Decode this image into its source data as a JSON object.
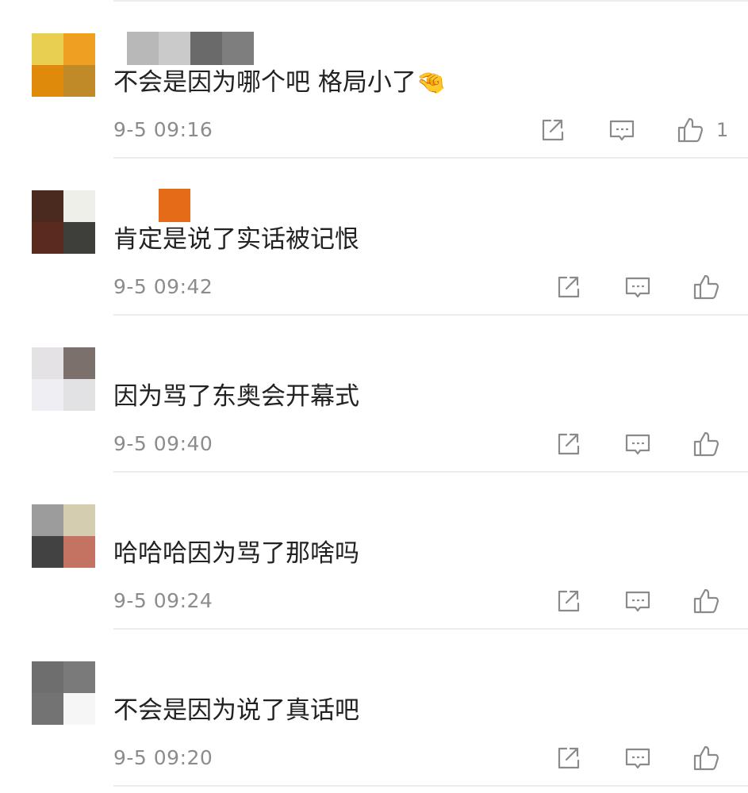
{
  "comments": [
    {
      "text": "不会是因为哪个吧 格局小了",
      "emoji": "🤏",
      "time": "9-5 09:16",
      "likes": "1",
      "avatar_colors": [
        "#e8cf50",
        "#f0a020",
        "#e08a0c",
        "#c08a28"
      ],
      "name_colors": [
        "#b8b8b8",
        "#cacaca",
        "#6a6a6a",
        "#7e7e7e"
      ]
    },
    {
      "text": "肯定是说了实话被记恨",
      "time": "9-5 09:42",
      "likes": "",
      "avatar_colors": [
        "#4a2a1f",
        "#efefe9",
        "#5a2a1e",
        "#3e3e3a"
      ],
      "name_colors": [
        "#ffffff",
        "#e56b18"
      ]
    },
    {
      "text": "因为骂了东奥会开幕式",
      "time": "9-5 09:40",
      "likes": "",
      "avatar_colors": [
        "#e4e2e4",
        "#7b706b",
        "#efeff3",
        "#e2e2e4"
      ],
      "name_colors": []
    },
    {
      "text": "哈哈哈因为骂了那啥吗",
      "time": "9-5 09:24",
      "likes": "",
      "avatar_colors": [
        "#9c9c9c",
        "#d4cdb0",
        "#424242",
        "#c47262"
      ],
      "name_colors": []
    },
    {
      "text": "不会是因为说了真话吧",
      "time": "9-5 09:20",
      "likes": "",
      "avatar_colors": [
        "#6e6e6e",
        "#7a7a7a",
        "#737373",
        "#f6f6f6"
      ],
      "name_colors": []
    }
  ],
  "icons": {
    "share": "share-icon",
    "reply": "comment-icon",
    "like": "thumbs-up-icon"
  },
  "colors": {
    "text": "#222222",
    "meta": "#8c8c8c",
    "icon": "#8a8a8a",
    "divider": "#ececec"
  }
}
